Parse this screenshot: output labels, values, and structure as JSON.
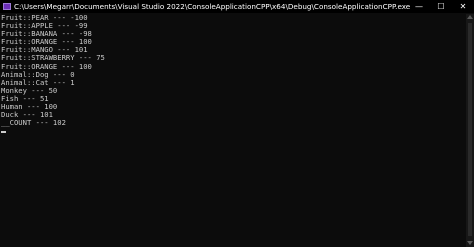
{
  "window": {
    "title": "C:\\Users\\Megarr\\Documents\\Visual Studio 2022\\ConsoleApplicationCPP\\x64\\Debug\\ConsoleApplicationCPP.exe",
    "minimize_glyph": "—",
    "maximize_glyph": "☐",
    "close_glyph": "✕"
  },
  "console": {
    "lines": [
      "Fruit::PEAR --- -100",
      "Fruit::APPLE --- -99",
      "Fruit::BANANA --- -98",
      "Fruit::ORANGE --- 100",
      "Fruit::MANGO --- 101",
      "Fruit::STRAWBERRY --- 75",
      "Fruit::ORANGE --- 100",
      "Animal::Dog --- 0",
      "Animal::Cat --- 1",
      "Monkey --- 50",
      "Fish --- 51",
      "Human --- 100",
      "Duck --- 101",
      "__COUNT --- 102"
    ]
  },
  "colors": {
    "background": "#0c0c0c",
    "text": "#cccccc",
    "icon": "#6c2fb8"
  }
}
